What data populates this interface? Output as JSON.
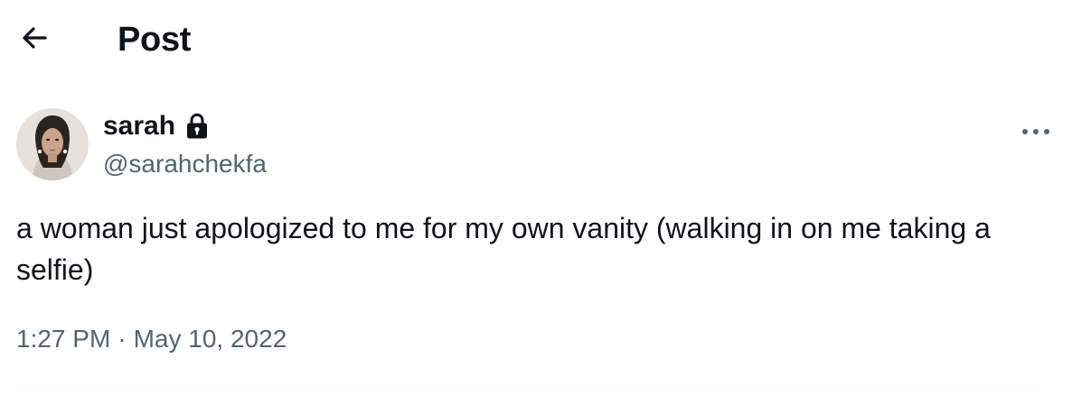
{
  "header": {
    "title": "Post",
    "back_icon": "arrow-left-icon"
  },
  "author": {
    "display_name": "sarah",
    "handle": "@sarahchekfa",
    "protected_icon": "lock-icon",
    "avatar_icon": "avatar-photo"
  },
  "post": {
    "text": "a woman just apologized to me for my own vanity (walking in on me taking a selfie)",
    "time": "1:27 PM",
    "separator": "·",
    "date": "May 10, 2022",
    "more_icon": "more-horizontal-icon"
  },
  "colors": {
    "text_primary": "#0f1419",
    "text_secondary": "#536471",
    "divider": "#eff3f4",
    "background": "#ffffff"
  }
}
